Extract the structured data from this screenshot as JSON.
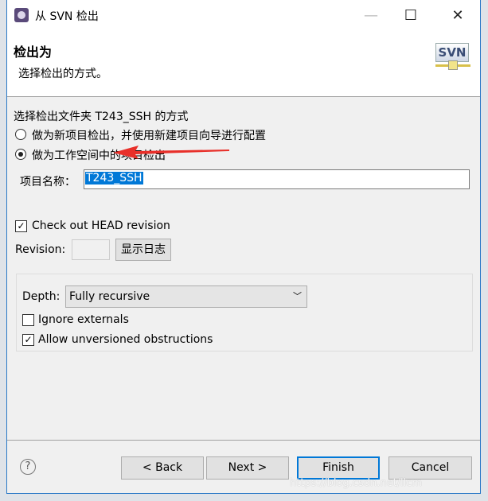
{
  "window": {
    "title": "从 SVN 检出",
    "minimize": "—",
    "maximize": "☐",
    "close": "✕"
  },
  "header": {
    "title": "检出为",
    "description": "选择检出的方式。",
    "logo_text": "SVN"
  },
  "options": {
    "prompt": "选择检出文件夹 T243_SSH 的方式",
    "radio_new": "做为新项目检出，并使用新建项目向导进行配置",
    "radio_workspace": "做为工作空间中的项目检出",
    "selected": "radio_workspace"
  },
  "project": {
    "label": "项目名称：",
    "value": "T243_SSH"
  },
  "head": {
    "label": "Check out HEAD revision",
    "checked": true
  },
  "revision": {
    "label": "Revision:",
    "value": "",
    "show_log": "显示日志"
  },
  "depth": {
    "label": "Depth:",
    "value": "Fully recursive"
  },
  "ignore": {
    "label": "Ignore externals",
    "checked": false
  },
  "allow": {
    "label": "Allow unversioned obstructions",
    "checked": true
  },
  "buttons": {
    "back": "< Back",
    "next": "Next >",
    "finish": "Finish",
    "cancel": "Cancel",
    "help": "?"
  },
  "annotation_color": "#e8302a",
  "watermark": "https://blog.csdn.net/llcm"
}
